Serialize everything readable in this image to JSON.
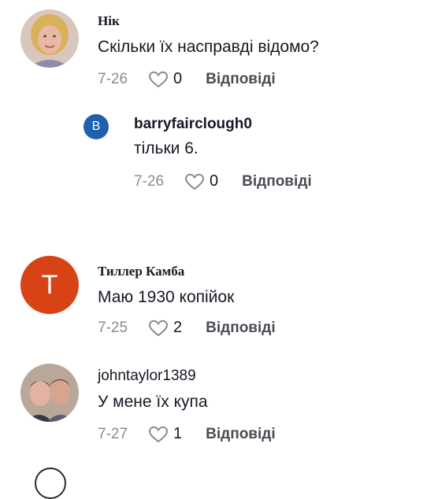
{
  "colors": {
    "text": "#161823",
    "muted": "#8a8b91",
    "avatar_b": "#1f5fb0",
    "avatar_t": "#d84315"
  },
  "comments": [
    {
      "username": "Нік",
      "text": "Скільки їх насправді відомо?",
      "date": "7-26",
      "likes": "0",
      "reply_label": "Відповіді",
      "avatar": "photo-woman",
      "replies": [
        {
          "username": "barryfairclough0",
          "text": "тільки 6.",
          "date": "7-26",
          "likes": "0",
          "reply_label": "Відповіді",
          "avatar_letter": "B"
        }
      ]
    },
    {
      "username": "Тиллер Камба",
      "text": "Маю 1930 копійок",
      "date": "7-25",
      "likes": "2",
      "reply_label": "Відповіді",
      "avatar_letter": "T"
    },
    {
      "username": "johntaylor1389",
      "text": "У мене їх купа",
      "date": "7-27",
      "likes": "1",
      "reply_label": "Відповіді",
      "avatar": "photo-couple"
    }
  ]
}
